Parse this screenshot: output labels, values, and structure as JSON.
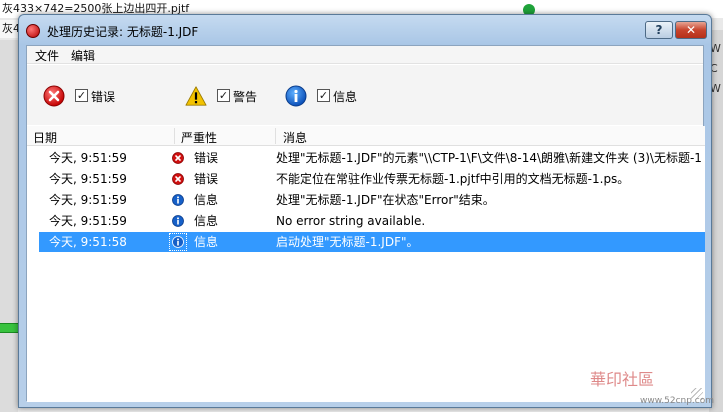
{
  "background": {
    "line1": "灰433×742=2500张上边出四开.pjtf",
    "line2": "灰4",
    "right_text": [
      "W",
      "C",
      "W"
    ]
  },
  "window": {
    "title": "处理历史记录: 无标题-1.JDF",
    "help_label": "?",
    "close_label": "✕"
  },
  "menu": {
    "file": "文件",
    "edit": "编辑"
  },
  "filters": {
    "error": {
      "label": "错误",
      "checked": "✓",
      "icon": "error-icon"
    },
    "warning": {
      "label": "警告",
      "checked": "✓",
      "icon": "warning-icon"
    },
    "info": {
      "label": "信息",
      "checked": "✓",
      "icon": "info-icon"
    }
  },
  "table": {
    "headers": {
      "date": "日期",
      "severity": "严重性",
      "message": "消息"
    },
    "rows": [
      {
        "date": "今天, 9:51:59",
        "severity": "错误",
        "icon": "error-icon",
        "message": "处理\"无标题-1.JDF\"的元素\"\\\\CTP-1\\F\\文件\\8-14\\朗雅\\新建文件夹 (3)\\无标题-1"
      },
      {
        "date": "今天, 9:51:59",
        "severity": "错误",
        "icon": "error-icon",
        "message": "不能定位在常驻作业传票无标题-1.pjtf中引用的文档无标题-1.ps。"
      },
      {
        "date": "今天, 9:51:59",
        "severity": "信息",
        "icon": "info-icon",
        "message": "处理\"无标题-1.JDF\"在状态\"Error\"结束。"
      },
      {
        "date": "今天, 9:51:59",
        "severity": "信息",
        "icon": "info-icon",
        "message": "No error string available."
      },
      {
        "date": "今天, 9:51:58",
        "severity": "信息",
        "icon": "info-icon",
        "message": "启动处理\"无标题-1.JDF\"。",
        "selected": true
      }
    ]
  },
  "watermark": {
    "text": "華印社區",
    "url": "www.52cnp.com"
  },
  "colors": {
    "selection": "#3399ff",
    "error": "#c40000",
    "info": "#0b4fb8",
    "warning": "#f2c200"
  }
}
